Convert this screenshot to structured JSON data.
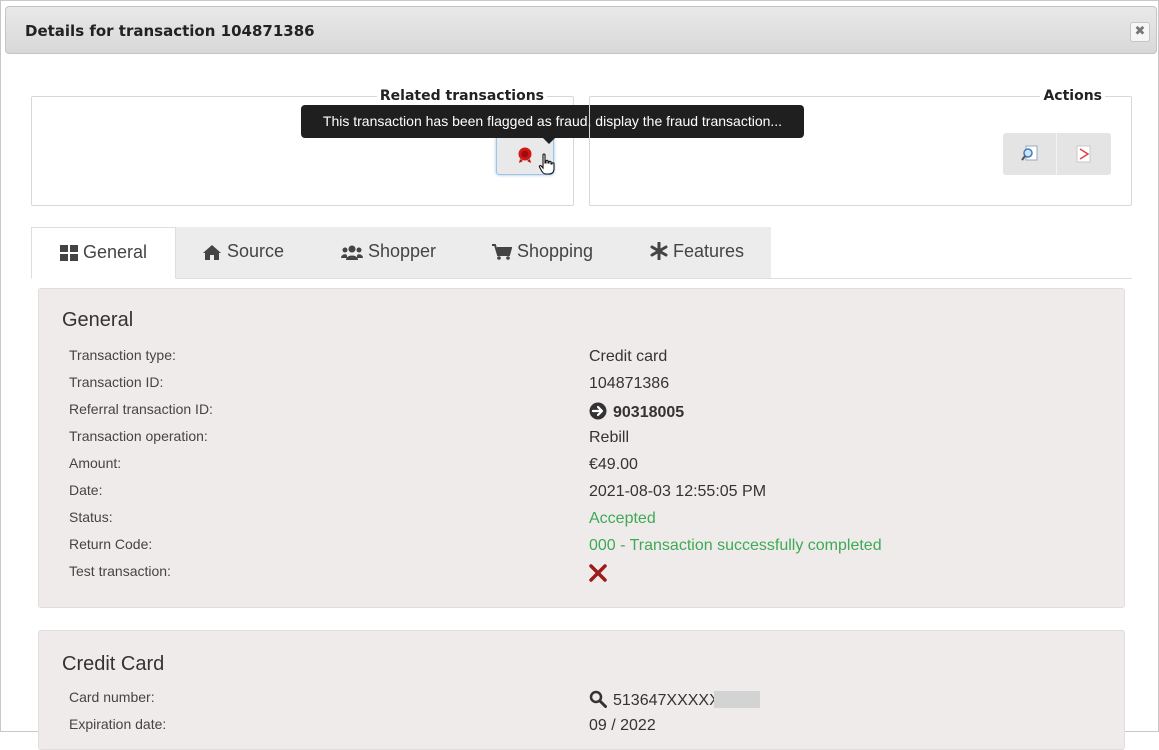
{
  "dialog": {
    "title": "Details for transaction 104871386",
    "close_label": "✖"
  },
  "related": {
    "legend": "Related transactions",
    "fraud_button_icon": "fraud-seal-icon"
  },
  "tooltip": {
    "text": "This transaction has been flagged as fraud, display the fraud transaction..."
  },
  "actions": {
    "legend": "Actions",
    "buttons": [
      {
        "icon": "search-document-icon"
      },
      {
        "icon": "pdf-icon"
      }
    ]
  },
  "tabs": [
    {
      "label": "General",
      "icon": "dashboard-icon",
      "active": true
    },
    {
      "label": "Source",
      "icon": "home-icon"
    },
    {
      "label": "Shopper",
      "icon": "users-icon"
    },
    {
      "label": "Shopping",
      "icon": "cart-icon"
    },
    {
      "label": "Features",
      "icon": "asterisk-icon"
    }
  ],
  "general": {
    "heading": "General",
    "rows": [
      {
        "label": "Transaction type:",
        "value": "Credit card"
      },
      {
        "label": "Transaction ID:",
        "value": "104871386"
      },
      {
        "label": "Referral transaction ID:",
        "value": "90318005"
      },
      {
        "label": "Transaction operation:",
        "value": "Rebill"
      },
      {
        "label": "Amount:",
        "value": "€49.00"
      },
      {
        "label": "Date:",
        "value": "2021-08-03 12:55:05 PM"
      },
      {
        "label": "Status:",
        "value": "Accepted"
      },
      {
        "label": "Return Code:",
        "value": "000 - Transaction successfully completed"
      },
      {
        "label": "Test transaction:",
        "value": "cross-icon"
      }
    ]
  },
  "credit_card": {
    "heading": "Credit Card",
    "rows": [
      {
        "label": "Card number:",
        "value": "513647XXXXX"
      },
      {
        "label": "Expiration date:",
        "value": "09 / 2022"
      }
    ]
  },
  "colors": {
    "status_green": "#3daa55",
    "section_bg": "#f0ebeb",
    "tooltip_bg": "#1f1f1f"
  }
}
